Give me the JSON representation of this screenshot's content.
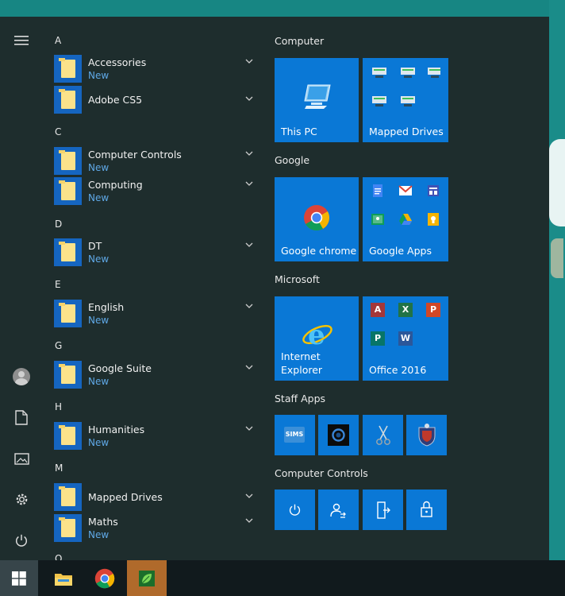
{
  "start_menu": {
    "app_list": {
      "sections": [
        {
          "letter": "A",
          "apps": [
            {
              "name": "Accessories",
              "sub": "New"
            },
            {
              "name": "Adobe CS5",
              "sub": ""
            }
          ]
        },
        {
          "letter": "C",
          "apps": [
            {
              "name": "Computer Controls",
              "sub": "New"
            },
            {
              "name": "Computing",
              "sub": "New"
            }
          ]
        },
        {
          "letter": "D",
          "apps": [
            {
              "name": "DT",
              "sub": "New"
            }
          ]
        },
        {
          "letter": "E",
          "apps": [
            {
              "name": "English",
              "sub": "New"
            }
          ]
        },
        {
          "letter": "G",
          "apps": [
            {
              "name": "Google Suite",
              "sub": "New"
            }
          ]
        },
        {
          "letter": "H",
          "apps": [
            {
              "name": "Humanities",
              "sub": "New"
            }
          ]
        },
        {
          "letter": "M",
          "apps": [
            {
              "name": "Mapped Drives",
              "sub": ""
            },
            {
              "name": "Maths",
              "sub": "New"
            }
          ]
        },
        {
          "letter": "O",
          "apps": []
        }
      ]
    },
    "tile_groups": {
      "computer": {
        "title": "Computer",
        "this_pc": "This PC",
        "mapped_drives": "Mapped Drives"
      },
      "google": {
        "title": "Google",
        "chrome": "Google chrome",
        "apps": "Google Apps"
      },
      "microsoft": {
        "title": "Microsoft",
        "ie_line1": "Internet",
        "ie_line2": "Explorer",
        "office": "Office 2016",
        "office_letters": [
          "A",
          "X",
          "P",
          "P",
          "W"
        ]
      },
      "staff_apps": {
        "title": "Staff Apps",
        "sims_label": "SIMS"
      },
      "computer_controls": {
        "title": "Computer Controls"
      }
    }
  },
  "colors": {
    "tile_blue": "#0a78d6",
    "menu_bg": "#1e2d2d",
    "new_text": "#5fa8e6",
    "folder_yellow": "#fbe28a",
    "desktop_teal": "#16807f"
  },
  "icons": {
    "rail": [
      "hamburger-icon",
      "user-avatar-icon",
      "documents-icon",
      "pictures-icon",
      "settings-gear-icon",
      "power-icon"
    ],
    "taskbar": [
      "windows-start-icon",
      "file-explorer-icon",
      "chrome-icon",
      "green-leaf-app-icon"
    ]
  }
}
